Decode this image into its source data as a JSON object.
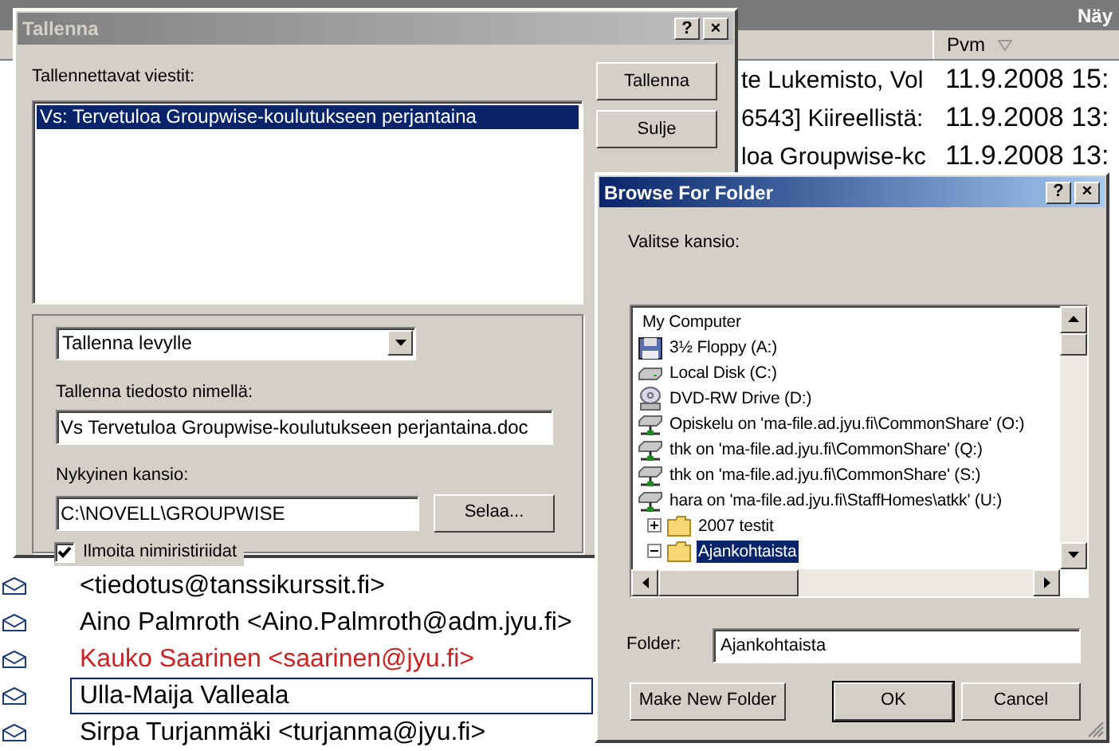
{
  "background_window": {
    "title": "Näy",
    "columns": [
      {
        "label": "Pvm",
        "sorted": true
      }
    ],
    "rows": [
      {
        "subject": "te Lukemisto, Vol",
        "date": "11.9.2008 15:"
      },
      {
        "subject": "6543] Kiireellistä:",
        "date": "11.9.2008 13:"
      },
      {
        "subject": "loa Groupwise-kc",
        "date": "11.9.2008 13:"
      }
    ],
    "sender_rows": [
      {
        "sender": "<tiedotus@tanssikurssit.fi>",
        "color": "#000000",
        "selected": false
      },
      {
        "sender": "Aino Palmroth <Aino.Palmroth@adm.jyu.fi>",
        "color": "#000000",
        "selected": false
      },
      {
        "sender": "Kauko Saarinen <saarinen@jyu.fi>",
        "color": "#cc2222",
        "selected": false
      },
      {
        "sender": "Ulla-Maija Valleala",
        "color": "#000000",
        "selected": true
      },
      {
        "sender": "Sirpa Turjanmäki <turjanma@jyu.fi>",
        "color": "#000000",
        "selected": false
      }
    ]
  },
  "save_dialog": {
    "title": "Tallenna",
    "help": "?",
    "close": "×",
    "messages_label": "Tallennettavat viestit:",
    "messages": [
      {
        "text": "Vs: Tervetuloa Groupwise-koulutukseen perjantaina",
        "selected": true
      }
    ],
    "buttons": [
      "Tallenna",
      "Sulje"
    ],
    "action_select": "Tallenna levylle",
    "filename_label": "Tallenna tiedosto nimellä:",
    "filename": "Vs Tervetuloa Groupwise-koulutukseen perjantaina.doc",
    "folder_label": "Nykyinen kansio:",
    "folder": "C:\\NOVELL\\GROUPWISE",
    "browse_button": "Selaa...",
    "notify_conflicts": {
      "label": "Ilmoita nimiristiriidat",
      "checked": true
    }
  },
  "browse_dialog": {
    "title": "Browse For Folder",
    "help": "?",
    "close": "×",
    "prompt": "Valitse kansio:",
    "tree": [
      {
        "label": "My Computer",
        "kind": "computer",
        "selected": false,
        "children": [
          {
            "label": "3½ Floppy (A:)",
            "kind": "floppy",
            "selected": false
          },
          {
            "label": "Local Disk (C:)",
            "kind": "disk",
            "selected": false
          },
          {
            "label": "DVD-RW Drive (D:)",
            "kind": "dvd",
            "selected": false
          },
          {
            "label": "Opiskelu on 'ma-file.ad.jyu.fi\\CommonShare' (O:)",
            "kind": "network",
            "selected": false
          },
          {
            "label": "thk on 'ma-file.ad.jyu.fi\\CommonShare' (Q:)",
            "kind": "network",
            "selected": false
          },
          {
            "label": "thk on 'ma-file.ad.jyu.fi\\CommonShare' (S:)",
            "kind": "network",
            "selected": false
          },
          {
            "label": "hara on 'ma-file.ad.jyu.fi\\StaffHomes\\atkk' (U:)",
            "kind": "network",
            "selected": false,
            "children": [
              {
                "label": "2007 testit",
                "kind": "folder",
                "expanded": false,
                "selected": false
              },
              {
                "label": "Ajankohtaista",
                "kind": "folder",
                "expanded": true,
                "selected": true
              }
            ]
          }
        ]
      }
    ],
    "folder_label": "Folder:",
    "folder_value": "Ajankohtaista",
    "buttons": [
      {
        "label": "Make New Folder",
        "default": false
      },
      {
        "label": "OK",
        "default": true
      },
      {
        "label": "Cancel",
        "default": false
      }
    ]
  }
}
